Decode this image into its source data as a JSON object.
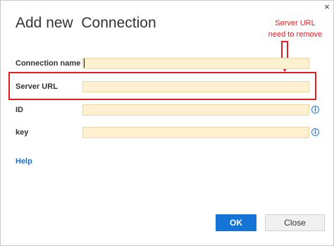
{
  "dialog": {
    "title": "Add new  Connection",
    "close_glyph": "×"
  },
  "annotation": {
    "line1": "Server URL",
    "line2": "need to remove",
    "color": "#e11d22"
  },
  "fields": [
    {
      "label": "Connection name",
      "value": "",
      "info": false
    },
    {
      "label": "Server URL",
      "value": "",
      "info": false
    },
    {
      "label": "ID",
      "value": "",
      "info": true
    },
    {
      "label": "key",
      "value": "",
      "info": true
    }
  ],
  "info_icon_glyph": "i",
  "help_label": "Help",
  "buttons": {
    "ok": "OK",
    "close": "Close"
  },
  "colors": {
    "accent": "#1574d6",
    "input_bg": "#fdf1cf"
  }
}
